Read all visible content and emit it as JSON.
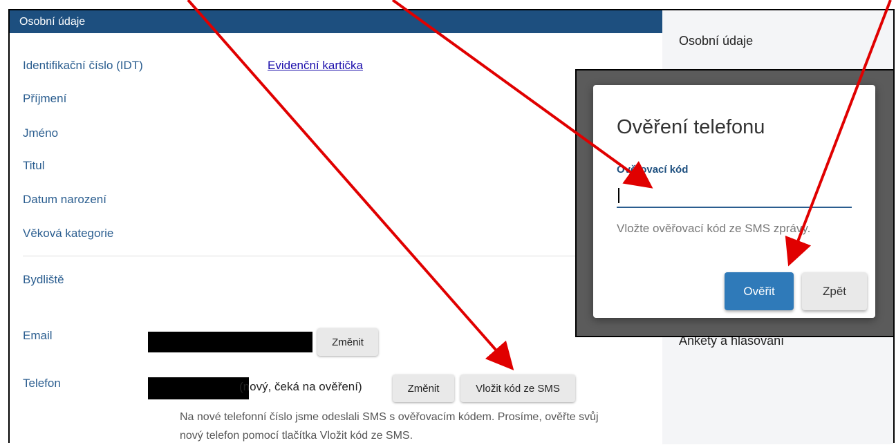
{
  "header": {
    "title": "Osobní údaje"
  },
  "fields": {
    "idt_label": "Identifikační číslo (IDT)",
    "idt_link": "Evidenční kartička",
    "surname_label": "Příjmení",
    "name_label": "Jméno",
    "title_label": "Titul",
    "birthdate_label": "Datum narození",
    "age_category_label": "Věková kategorie",
    "residence_label": "Bydliště",
    "email_label": "Email",
    "phone_label": "Telefon"
  },
  "email": {
    "change_button": "Změnit"
  },
  "phone": {
    "status": "(nový, čeká na ověření)",
    "change_button": "Změnit",
    "enter_code_button": "Vložit kód ze SMS",
    "info": "Na nové telefonní číslo jsme odeslali SMS s ověřovacím kódem. Prosíme, ověřte svůj nový telefon pomocí tlačítka Vložit kód ze SMS."
  },
  "sidebar": {
    "title": "Osobní údaje",
    "item": "Ankety a hlasování"
  },
  "dialog": {
    "title": "Ověření telefonu",
    "field_label": "Ověřovací kód",
    "code_value": "",
    "help": "Vložte ověřovací kód ze SMS zprávy.",
    "verify_button": "Ověřit",
    "back_button": "Zpět"
  },
  "colors": {
    "header": "#1d4f7f",
    "label": "#2a5d8f",
    "primary_button": "#2f7ab9",
    "annotation_arrow": "#e00000"
  }
}
